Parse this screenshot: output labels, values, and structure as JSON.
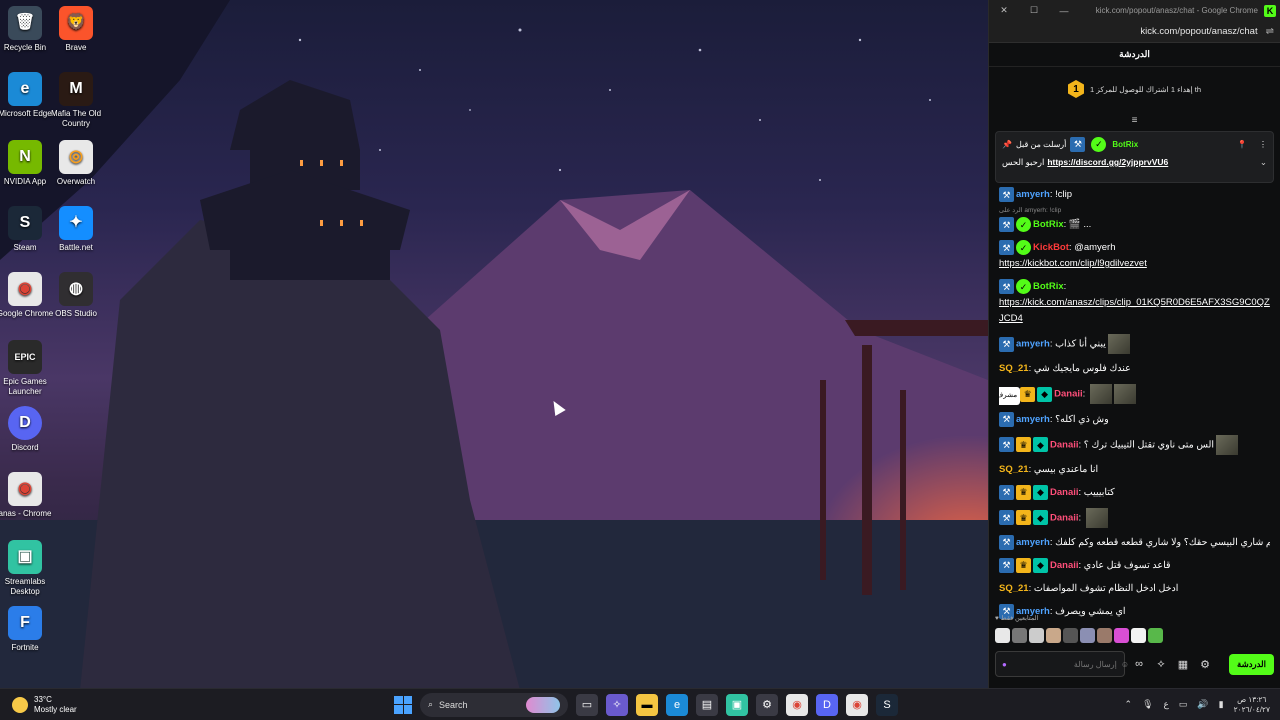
{
  "desktop": {
    "icons": [
      {
        "label": "Recycle Bin",
        "glyph": "🗑",
        "bg": "#3a4a5a"
      },
      {
        "label": "Brave",
        "glyph": "🦁",
        "bg": "#fb542b"
      },
      {
        "label": "Microsoft Edge",
        "glyph": "e",
        "bg": "#1b8ad6"
      },
      {
        "label": "Mafia The Old Country",
        "glyph": "M",
        "bg": "#2a1a14"
      },
      {
        "label": "NVIDIA App",
        "glyph": "N",
        "bg": "#76b900"
      },
      {
        "label": "Overwatch",
        "glyph": "◎",
        "bg": "#e8e8e8"
      },
      {
        "label": "Steam",
        "glyph": "S",
        "bg": "#1b2838"
      },
      {
        "label": "Battle.net",
        "glyph": "✦",
        "bg": "#148eff"
      },
      {
        "label": "Google Chrome",
        "glyph": "◉",
        "bg": "#e8e8e8"
      },
      {
        "label": "OBS Studio",
        "glyph": "◍",
        "bg": "#302e31"
      },
      {
        "label": "Epic Games Launcher",
        "glyph": "EPIC",
        "bg": "#2a2a2a"
      },
      {
        "label": "Discord",
        "glyph": "D",
        "bg": "#5865f2"
      },
      {
        "label": "anas - Chrome",
        "glyph": "◉",
        "bg": "#e8e8e8"
      },
      {
        "label": "Streamlabs Desktop",
        "glyph": "▣",
        "bg": "#31c3a2"
      },
      {
        "label": "Fortnite",
        "glyph": "F",
        "bg": "#2b7de9"
      }
    ]
  },
  "window": {
    "title": "kick.com/popout/anasz/chat - Google Chrome",
    "url": "kick.com/popout/anasz/chat",
    "min_label": "—",
    "max_label": "☐",
    "close_label": "✕",
    "kick_logo": "K"
  },
  "chat": {
    "header": "الدردشة",
    "goal_number": "1",
    "goal_text": "إهداء 1 اشتراك للوصول للمركز 1 th",
    "pinned": {
      "sender": "BotRix",
      "sent_by": "أرسلت من قبل",
      "prefix": "ارحبو الحس",
      "link": "https://discord.gg/2yjpprvVU6"
    },
    "messages": [
      {
        "user": "amyerh",
        "color": "#4fa3ff",
        "text": "!clip"
      },
      {
        "reply": "الرد على amyerh: !clip"
      },
      {
        "user": "BotRix",
        "color": "#53fc18",
        "text": "🎬 ..."
      },
      {
        "user": "KickBot",
        "color": "#ff3b3b",
        "text": "@amyerh",
        "link": "https://kickbot.com/clip/l9gdilvezvet"
      },
      {
        "user": "BotRix",
        "color": "#53fc18",
        "text": "",
        "link": "https://kick.com/anasz/clips/clip_01KQ5R0D6E5AFX3SG9C0QZJCD4"
      },
      {
        "user": "amyerh",
        "color": "#4fa3ff",
        "text": "يبني أنا كذاب"
      },
      {
        "user": "SQ_21",
        "color": "#f3b51b",
        "text": "عندك فلوس مايجيك شي"
      },
      {
        "user": "Danaii",
        "color": "#ff4f7a",
        "text": ""
      },
      {
        "user": "amyerh",
        "color": "#4fa3ff",
        "text": "وش ذي اكله؟"
      },
      {
        "user": "Danaii",
        "color": "#ff4f7a",
        "text": "الس متى ناوي تقتل التيبيك ترك ؟"
      },
      {
        "user": "SQ_21",
        "color": "#f3b51b",
        "text": "انا ماعندي بيسي"
      },
      {
        "user": "Danaii",
        "color": "#ff4f7a",
        "text": "كتابيييب"
      },
      {
        "user": "Danaii",
        "color": "#ff4f7a",
        "text": ""
      },
      {
        "user": "amyerh",
        "color": "#4fa3ff",
        "text": "كم شاري البيسي حقك؟ ولا شاري قطعه قطعه وكم كلفك"
      },
      {
        "user": "Danaii",
        "color": "#ff4f7a",
        "text": "قاعد تسوف قتل عادي"
      },
      {
        "user": "SQ_21",
        "color": "#f3b51b",
        "text": "ادخل ادخل النظام تشوف المواصفات"
      },
      {
        "user": "amyerh",
        "color": "#4fa3ff",
        "text": "اي يمشي ويصرف"
      }
    ],
    "mod_tooltip": "مشرف",
    "chatters_label": "المتابعين فقط",
    "input_placeholder": "إرسال رسالة",
    "chat_button": "الدردشة"
  },
  "taskbar": {
    "temp": "33°C",
    "weather": "Mostly clear",
    "search": "Search",
    "time": "١٣:٢٦ ص",
    "date": "٢٠٢٦/٠٤/٢٧"
  }
}
